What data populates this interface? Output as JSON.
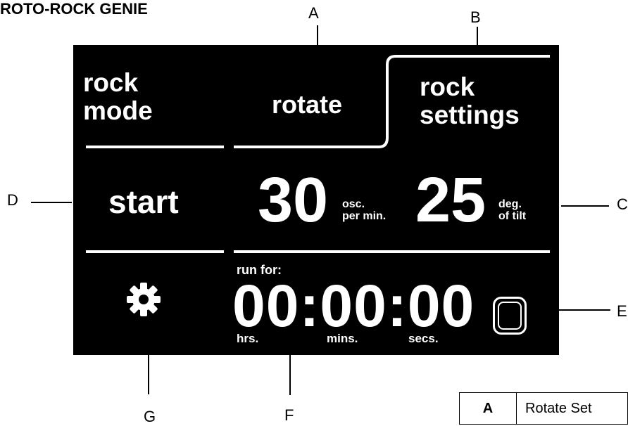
{
  "title": "ROTO-ROCK GENIE",
  "callouts": {
    "A": "A",
    "B": "B",
    "C": "C",
    "D": "D",
    "E": "E",
    "F": "F",
    "G": "G"
  },
  "screen": {
    "tab_left": "rock\nmode",
    "tab_mid": "rotate",
    "tab_right": "rock\nsettings",
    "start": "start",
    "speed_value": "30",
    "speed_unit": "osc.\nper min.",
    "tilt_value": "25",
    "tilt_unit": "deg.\nof tilt",
    "run_for_label": "run for:",
    "timer": "00:00:00",
    "hrs_label": "hrs.",
    "mins_label": "mins.",
    "secs_label": "secs."
  },
  "legend_table": {
    "rows": [
      {
        "key": "A",
        "value": "Rotate Set"
      }
    ]
  },
  "icons": {
    "settings": "gear-icon",
    "stop": "stop-square-icon"
  }
}
